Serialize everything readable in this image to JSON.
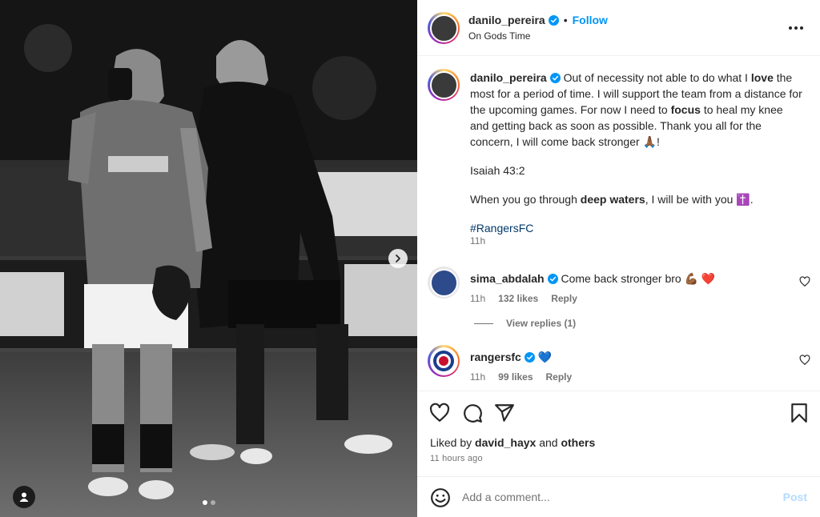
{
  "post": {
    "username": "danilo_pereira",
    "follow_label": "Follow",
    "separator": "•",
    "subtitle": "On Gods Time",
    "caption": {
      "p1_a": "Out of necessity not able to do what I ",
      "p1_b": "love",
      "p1_c": " the most for a period of time. I will support the team from a distance for the upcoming games. For now I need to ",
      "p1_d": "focus",
      "p1_e": " to heal my knee and getting back as soon as possible. Thank you all for the concern, I will come back stronger ",
      "p1_emoji": "🙏🏾",
      "p1_f": "!",
      "p2": "Isaiah 43:2",
      "p3_a": "When you go through ",
      "p3_b": "deep waters",
      "p3_c": ", I will be with you ",
      "p3_emoji": "✝️",
      "p3_d": ".",
      "hashtag": "#RangersFC",
      "time": "11h"
    }
  },
  "comments": [
    {
      "username": "sima_abdalah",
      "text": "Come back stronger bro ",
      "emoji": "💪🏾 ❤️",
      "time": "11h",
      "likes": "132 likes",
      "reply_label": "Reply"
    },
    {
      "username": "rangersfc",
      "text": "",
      "emoji": "💙",
      "time": "11h",
      "likes": "99 likes",
      "reply_label": "Reply"
    }
  ],
  "view_replies": "View replies (1)",
  "actions": {
    "liked_by_prefix": "Liked by ",
    "liked_by_user": "david_hayx",
    "liked_by_and": " and ",
    "liked_by_others": "others",
    "time_ago": "11 hours ago"
  },
  "add_comment": {
    "placeholder": "Add a comment...",
    "post_label": "Post"
  },
  "media": {
    "carousel_count": 2,
    "carousel_active": 1
  },
  "colors": {
    "link_blue": "#0095f6",
    "hashtag": "#00376b",
    "verified": "#0095f6",
    "heart_red": "#ed4956",
    "post_disabled": "#b3dbff"
  },
  "icons": [
    "verified-badge-icon",
    "more-options-icon",
    "heart-icon",
    "comment-icon",
    "share-icon",
    "bookmark-icon",
    "emoji-icon",
    "chevron-right-icon",
    "user-tag-icon"
  ]
}
